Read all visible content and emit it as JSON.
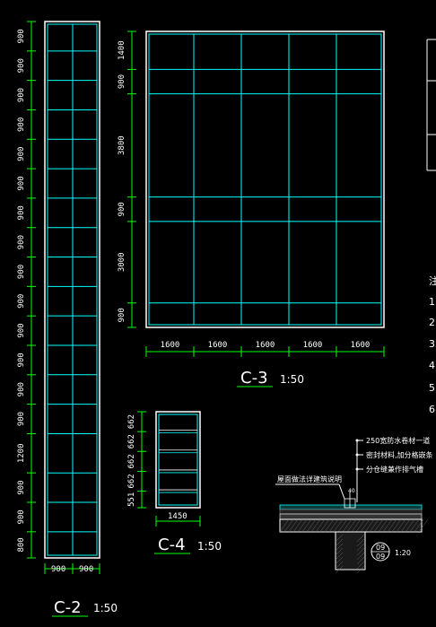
{
  "elevation_c2": {
    "title": "C-2",
    "scale": "1:50",
    "side_dims": [
      "900",
      "900",
      "900",
      "900",
      "900",
      "900",
      "900",
      "900",
      "900",
      "900",
      "900",
      "900",
      "900",
      "900",
      "1200",
      "900",
      "900",
      "800"
    ],
    "bottom_dims": [
      "900",
      "900"
    ]
  },
  "elevation_c3": {
    "title": "C-3",
    "scale": "1:50",
    "side_dims": [
      "1400",
      "900",
      "3800",
      "900",
      "3000",
      "900"
    ],
    "bottom_dims": [
      "1600",
      "1600",
      "1600",
      "1600",
      "1600"
    ]
  },
  "elevation_c4": {
    "title": "C-4",
    "scale": "1:50",
    "side_dims": [
      "662",
      "662",
      "662",
      "662",
      "551"
    ],
    "bottom_dims": [
      "1450"
    ]
  },
  "detail": {
    "notes": [
      "250宽防水卷材一道",
      "密封材料,加分格嵌条",
      "分仓缝兼作排气槽"
    ],
    "left_note": "屋面做法详建筑说明",
    "small_label": "40",
    "callout_top": "09",
    "callout_bottom": "09",
    "scale": "1:20"
  },
  "right_edge_labels": [
    "注",
    "1",
    "2",
    "3",
    "4",
    "5",
    "6"
  ],
  "colors": {
    "line": "#00ffff",
    "dim": "#00ff00",
    "frame": "#ffffff",
    "bg": "#000000"
  }
}
